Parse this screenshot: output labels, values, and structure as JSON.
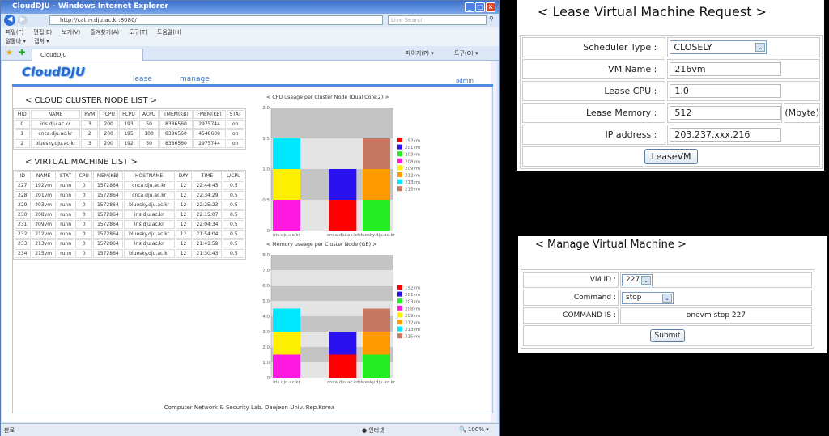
{
  "browser": {
    "title": "CloudDJU - Windows Internet Explorer",
    "url": "http://cathy.dju.ac.kr:8080/",
    "search_placeholder": "Live Search",
    "menu": [
      "파일(F)",
      "편집(E)",
      "보기(V)",
      "즐겨찾기(A)",
      "도구(T)",
      "도움말(H)"
    ],
    "toolbar": [
      "알툴바 ▾",
      "캡처 ▾"
    ],
    "tab": "CloudDJU",
    "right_tools": [
      "페이지(P) ▾",
      "도구(O) ▾"
    ],
    "status": {
      "left": "완료",
      "zone": "인터넷",
      "zoom": "100%"
    }
  },
  "site": {
    "logo": "CloudDJU",
    "nav": [
      "lease",
      "manage"
    ],
    "user": "admin",
    "footer": "Computer Network & Security Lab. Daejeon Univ. Rep.Korea"
  },
  "cluster": {
    "title": "< CLOUD CLUSTER NODE LIST >",
    "headers": [
      "HID",
      "NAME",
      "RVM",
      "TCPU",
      "FCPU",
      "ACPU",
      "TMEM(KB)",
      "FMEM(KB)",
      "STAT"
    ],
    "rows": [
      [
        "0",
        "iris.dju.ac.kr",
        "3",
        "200",
        "193",
        "50",
        "8386560",
        "2975744",
        "on"
      ],
      [
        "1",
        "cnca.dju.ac.kr",
        "2",
        "200",
        "195",
        "100",
        "8386560",
        "4548608",
        "on"
      ],
      [
        "2",
        "bluesky.dju.ac.kr",
        "3",
        "200",
        "192",
        "50",
        "8386560",
        "2975744",
        "on"
      ]
    ]
  },
  "vms": {
    "title": "< VIRTUAL MACHINE LIST >",
    "headers": [
      "ID",
      "NAME",
      "STAT",
      "CPU",
      "MEM(KB)",
      "HOSTNAME",
      "DAY",
      "TIME",
      "L/CPU"
    ],
    "rows": [
      [
        "227",
        "192vm",
        "runn",
        "0",
        "1572864",
        "cnca.dju.ac.kr",
        "12",
        "22:44:43",
        "0.5"
      ],
      [
        "228",
        "201vm",
        "runn",
        "0",
        "1572864",
        "cnca.dju.ac.kr",
        "12",
        "22:34:29",
        "0.5"
      ],
      [
        "229",
        "203vm",
        "runn",
        "0",
        "1572864",
        "bluesky.dju.ac.kr",
        "12",
        "22:25:23",
        "0.5"
      ],
      [
        "230",
        "208vm",
        "runn",
        "0",
        "1572864",
        "iris.dju.ac.kr",
        "12",
        "22:15:07",
        "0.5"
      ],
      [
        "231",
        "209vm",
        "runn",
        "0",
        "1572864",
        "iris.dju.ac.kr",
        "12",
        "22:04:34",
        "0.5"
      ],
      [
        "232",
        "212vm",
        "runn",
        "0",
        "1572864",
        "bluesky.dju.ac.kr",
        "12",
        "21:54:04",
        "0.5"
      ],
      [
        "233",
        "213vm",
        "runn",
        "0",
        "1572864",
        "iris.dju.ac.kr",
        "12",
        "21:41:59",
        "0.5"
      ],
      [
        "234",
        "215vm",
        "runn",
        "0",
        "1572864",
        "bluesky.dju.ac.kr",
        "12",
        "21:30:43",
        "0.5"
      ]
    ]
  },
  "chart_data": [
    {
      "type": "bar",
      "stacked": true,
      "title": "< CPU useage per Cluster Node (Dual Core:2) >",
      "categories": [
        "iris.dju.ac.kr",
        "cnca.dju.ac.kr",
        "bluesky.dju.ac.kr"
      ],
      "ylim": [
        0,
        2.0
      ],
      "yticks": [
        "0",
        "0.5",
        "1.0",
        "1.5",
        "2.0"
      ],
      "ytick_values": [
        0,
        0.5,
        1,
        1.5,
        2
      ],
      "band": 0.5,
      "legend": "right",
      "series": [
        {
          "name": "192vm",
          "color": "#ff0000",
          "values": [
            0,
            0.5,
            0
          ]
        },
        {
          "name": "201vm",
          "color": "#2a12f0",
          "values": [
            0,
            0.5,
            0
          ]
        },
        {
          "name": "203vm",
          "color": "#22ee22",
          "values": [
            0,
            0,
            0.5
          ]
        },
        {
          "name": "208vm",
          "color": "#ff18e0",
          "values": [
            0.5,
            0,
            0
          ]
        },
        {
          "name": "209vm",
          "color": "#ffef00",
          "values": [
            0.5,
            0,
            0
          ]
        },
        {
          "name": "212vm",
          "color": "#ff9a00",
          "values": [
            0,
            0,
            0.5
          ]
        },
        {
          "name": "213vm",
          "color": "#00e8ff",
          "values": [
            0.5,
            0,
            0
          ]
        },
        {
          "name": "215vm",
          "color": "#c87860",
          "values": [
            0,
            0,
            0.5
          ]
        }
      ]
    },
    {
      "type": "bar",
      "stacked": true,
      "title": "< Memory useage per Cluster Node (GB) >",
      "categories": [
        "iris.dju.ac.kr",
        "cnca.dju.ac.kr",
        "bluesky.dju.ac.kr"
      ],
      "ylim": [
        0,
        8.0
      ],
      "yticks": [
        "0",
        "1.0",
        "2.0",
        "3.0",
        "4.0",
        "5.0",
        "6.0",
        "7.0",
        "8.0"
      ],
      "ytick_values": [
        0,
        1,
        2,
        3,
        4,
        5,
        6,
        7,
        8
      ],
      "band": 1,
      "legend": "right",
      "series": [
        {
          "name": "192vm",
          "color": "#ff0000",
          "values": [
            0,
            1.5,
            0
          ]
        },
        {
          "name": "201vm",
          "color": "#2a12f0",
          "values": [
            0,
            1.5,
            0
          ]
        },
        {
          "name": "203vm",
          "color": "#22ee22",
          "values": [
            0,
            0,
            1.5
          ]
        },
        {
          "name": "208vm",
          "color": "#ff18e0",
          "values": [
            1.5,
            0,
            0
          ]
        },
        {
          "name": "209vm",
          "color": "#ffef00",
          "values": [
            1.5,
            0,
            0
          ]
        },
        {
          "name": "212vm",
          "color": "#ff9a00",
          "values": [
            0,
            0,
            1.5
          ]
        },
        {
          "name": "213vm",
          "color": "#00e8ff",
          "values": [
            1.5,
            0,
            0
          ]
        },
        {
          "name": "215vm",
          "color": "#c87860",
          "values": [
            0,
            0,
            1.5
          ]
        }
      ]
    }
  ],
  "lease": {
    "title": "< Lease Virtual Machine Request >",
    "scheduler_label": "Scheduler Type  :",
    "scheduler_value": "CLOSELY",
    "name_label": "VM Name  :",
    "name_value": "216vm",
    "cpu_label": "Lease CPU  :",
    "cpu_value": "1.0",
    "mem_label": "Lease Memory  :",
    "mem_value": "512",
    "mem_unit": "(Mbyte)",
    "ip_label": "IP address  :",
    "ip_value": "203.237.xxx.216",
    "button": "LeaseVM"
  },
  "manage": {
    "title": "< Manage Virtual Machine >",
    "id_label": "VM ID :",
    "id_value": "227",
    "cmd_label": "Command :",
    "cmd_value": "stop",
    "is_label": "COMMAND IS :",
    "is_value": "onevm stop 227",
    "button": "Submit"
  }
}
